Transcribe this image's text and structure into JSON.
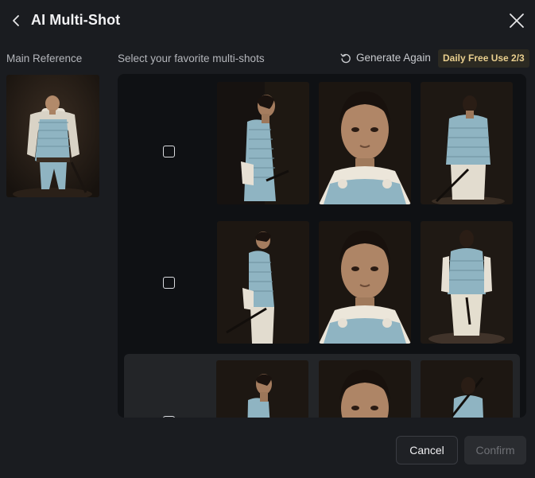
{
  "dialog": {
    "title": "AI Multi-Shot"
  },
  "reference": {
    "label": "Main Reference",
    "image": "armored-warrior-front"
  },
  "shots_section": {
    "label": "Select your favorite multi-shots",
    "generate_again_label": "Generate Again",
    "daily_badge": "Daily Free Use 2/3",
    "rows": [
      {
        "checked": false,
        "images": [
          "warrior-side-profile-right",
          "warrior-portrait-closeup",
          "warrior-back-turned"
        ]
      },
      {
        "checked": false,
        "images": [
          "warrior-side-full-body",
          "warrior-portrait-closeup",
          "warrior-back-full-body"
        ]
      },
      {
        "checked": false,
        "images": [
          "warrior-side-profile",
          "warrior-portrait-closeup",
          "warrior-back-sword"
        ]
      }
    ]
  },
  "footer": {
    "cancel_label": "Cancel",
    "confirm_label": "Confirm"
  },
  "colors": {
    "background": "#1a1c20",
    "panel": "#0f1114",
    "badge_text": "#e9cf8e",
    "armor": "#8fb4c2"
  },
  "icons": [
    "back-arrow-icon",
    "close-icon",
    "refresh-icon",
    "checkbox-icon"
  ]
}
